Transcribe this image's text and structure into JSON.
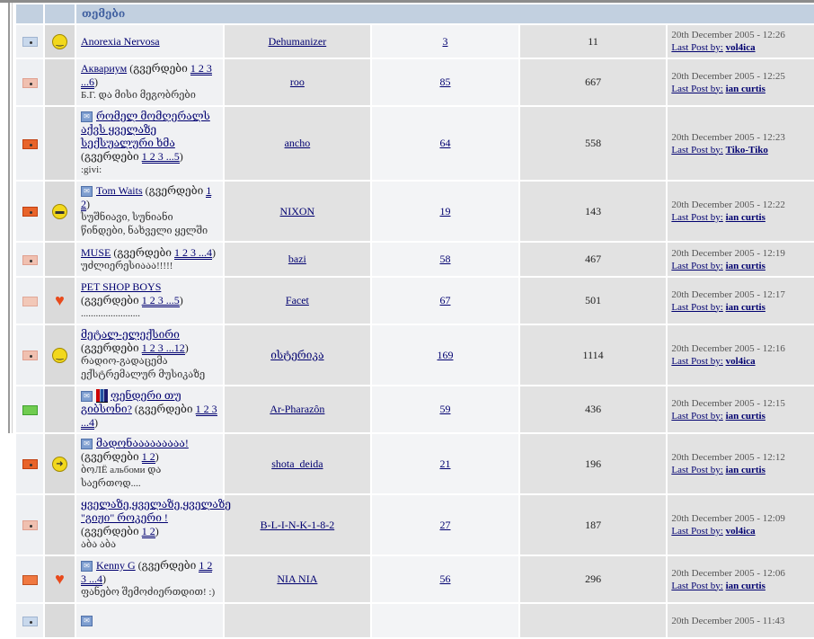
{
  "header": {
    "title": "თემები"
  },
  "pages_word": "გვერდები",
  "rows": [
    {
      "status": "read",
      "emoticon": "smile",
      "title": "Anorexia Nervosa",
      "pages": "",
      "desc": "",
      "starter": "Dehumanizer",
      "replies": "3",
      "views": "11",
      "date": "20th December 2005 - 12:26",
      "last_by_label": "Last Post by:",
      "last_by": "vol4ica",
      "mini": false
    },
    {
      "status": "old",
      "emoticon": "",
      "title": "Аквариум",
      "pages": "1 2 3 ...6",
      "desc": "Б.Г. და მისი მეგობრები",
      "starter": "roo",
      "replies": "85",
      "views": "667",
      "date": "20th December 2005 - 12:25",
      "last_by_label": "Last Post by:",
      "last_by": "ian curtis",
      "mini": false
    },
    {
      "status": "new",
      "emoticon": "",
      "title": "რომელ მომღერალს აქვს ყველაზე სექსუალური ხმა",
      "pages": "1 2 3 ...5",
      "desc": ":givi:",
      "starter": "ancho",
      "replies": "64",
      "views": "558",
      "date": "20th December 2005 - 12:23",
      "last_by_label": "Last Post by:",
      "last_by": "Tiko-Tiko",
      "mini": true
    },
    {
      "status": "new",
      "emoticon": "cool",
      "title": "Tom Waits",
      "pages": "1 2",
      "desc": "სუშნიავი, სუნიანი წინდები, ნახველი ყელში",
      "starter": "NIXON",
      "replies": "19",
      "views": "143",
      "date": "20th December 2005 - 12:22",
      "last_by_label": "Last Post by:",
      "last_by": "ian curtis",
      "mini": true
    },
    {
      "status": "old",
      "emoticon": "",
      "title": "MUSE",
      "pages": "1 2 3 ...4",
      "desc": "უძლიერესიააა!!!!!",
      "starter": "bazi",
      "replies": "58",
      "views": "467",
      "date": "20th December 2005 - 12:19",
      "last_by_label": "Last Post by:",
      "last_by": "ian curtis",
      "mini": false
    },
    {
      "status": "oldplain",
      "emoticon": "heart",
      "title": "PET SHOP BOYS",
      "pages": "1 2 3 ...5",
      "desc": "........................",
      "starter": "Facet",
      "replies": "67",
      "views": "501",
      "date": "20th December 2005 - 12:17",
      "last_by_label": "Last Post by:",
      "last_by": "ian curtis",
      "mini": false
    },
    {
      "status": "old",
      "emoticon": "smile",
      "title": "მეტალ-ელექსირი",
      "pages": "1 2 3 ...12",
      "desc": "რადიო-გადაცემა ექსტრემალურ მუსიკაზე",
      "starter": "ისტერიკა",
      "replies": "169",
      "views": "1114",
      "date": "20th December 2005 - 12:16",
      "last_by_label": "Last Post by:",
      "last_by": "vol4ica",
      "mini": false
    },
    {
      "status": "green",
      "emoticon": "",
      "title": "ფენდერი თუ გიბსონი?",
      "pages": "1 2 3 ...4",
      "desc": "",
      "starter": "Ar-Pharazôn",
      "replies": "59",
      "views": "436",
      "date": "20th December 2005 - 12:15",
      "last_by_label": "Last Post by:",
      "last_by": "ian curtis",
      "mini": true,
      "poll": true
    },
    {
      "status": "new",
      "emoticon": "arrow",
      "title": "მადონააააააააა!",
      "pages": "1 2",
      "desc": "ბოЛЁ альбоми და საერთოდ....",
      "starter": "shota_deida",
      "replies": "21",
      "views": "196",
      "date": "20th December 2005 - 12:12",
      "last_by_label": "Last Post by:",
      "last_by": "ian curtis",
      "mini": true
    },
    {
      "status": "old",
      "emoticon": "",
      "title": "ყველაზე,ყველაზე,ყველაზე \"გიჟი\" როკერი !",
      "pages": "1 2",
      "desc": "აბა აბა",
      "starter": "B-L-I-N-K-1-8-2",
      "replies": "27",
      "views": "187",
      "date": "20th December 2005 - 12:09",
      "last_by_label": "Last Post by:",
      "last_by": "vol4ica",
      "mini": false
    },
    {
      "status": "hot",
      "emoticon": "heart",
      "title": "Kenny G",
      "pages": "1 2 3 ...4",
      "desc": "ფანებო შემოძიერთდით! :)",
      "starter": "NIA NIA",
      "replies": "56",
      "views": "296",
      "date": "20th December 2005 - 12:06",
      "last_by_label": "Last Post by:",
      "last_by": "ian curtis",
      "mini": true
    },
    {
      "status": "read",
      "emoticon": "",
      "title": "",
      "pages": "",
      "desc": "",
      "starter": "",
      "replies": "",
      "views": "",
      "date": "20th December 2005 - 11:43",
      "last_by_label": "",
      "last_by": "",
      "mini": true
    }
  ]
}
